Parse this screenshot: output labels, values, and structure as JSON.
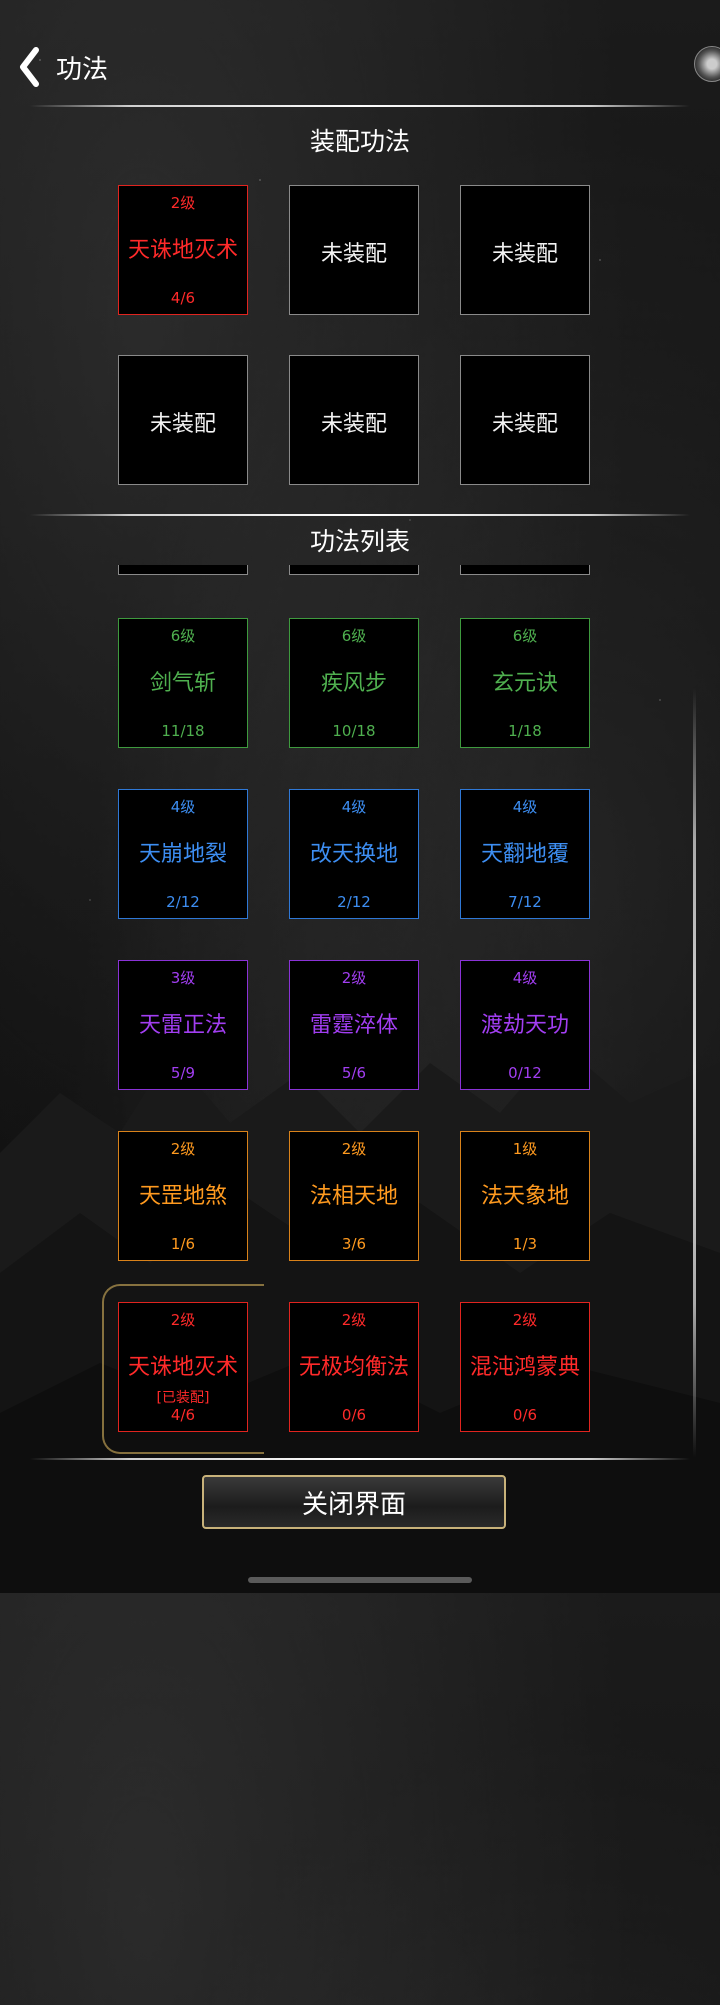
{
  "header": {
    "title": "功法"
  },
  "equipped": {
    "title": "装配功法",
    "slots": [
      {
        "level": "2级",
        "name": "天诛地灭术",
        "progress": "4/6",
        "color": "#ff2a2a",
        "border": "#e0241f"
      },
      {
        "name": "未装配"
      },
      {
        "name": "未装配"
      },
      {
        "name": "未装配"
      },
      {
        "name": "未装配"
      },
      {
        "name": "未装配"
      }
    ]
  },
  "list": {
    "title": "功法列表",
    "items": [
      {
        "level": "6级",
        "name": "剑气斩",
        "progress": "11/18",
        "color": "#4fb04f",
        "border": "#3e9a3e"
      },
      {
        "level": "6级",
        "name": "疾风步",
        "progress": "10/18",
        "color": "#4fb04f",
        "border": "#3e9a3e"
      },
      {
        "level": "6级",
        "name": "玄元诀",
        "progress": "1/18",
        "color": "#4fb04f",
        "border": "#3e9a3e"
      },
      {
        "level": "4级",
        "name": "天崩地裂",
        "progress": "2/12",
        "color": "#3d8ef2",
        "border": "#2f78d6"
      },
      {
        "level": "4级",
        "name": "改天换地",
        "progress": "2/12",
        "color": "#3d8ef2",
        "border": "#2f78d6"
      },
      {
        "level": "4级",
        "name": "天翻地覆",
        "progress": "7/12",
        "color": "#3d8ef2",
        "border": "#2f78d6"
      },
      {
        "level": "3级",
        "name": "天雷正法",
        "progress": "5/9",
        "color": "#a23ef2",
        "border": "#8a32d6"
      },
      {
        "level": "2级",
        "name": "雷霆淬体",
        "progress": "5/6",
        "color": "#a23ef2",
        "border": "#8a32d6"
      },
      {
        "level": "4级",
        "name": "渡劫天功",
        "progress": "0/12",
        "color": "#a23ef2",
        "border": "#8a32d6"
      },
      {
        "level": "2级",
        "name": "天罡地煞",
        "progress": "1/6",
        "color": "#ff9a1f",
        "border": "#d9821a"
      },
      {
        "level": "2级",
        "name": "法相天地",
        "progress": "3/6",
        "color": "#ff9a1f",
        "border": "#d9821a"
      },
      {
        "level": "1级",
        "name": "法天象地",
        "progress": "1/3",
        "color": "#ff9a1f",
        "border": "#d9821a"
      },
      {
        "level": "2级",
        "name": "天诛地灭术",
        "tag": "[已装配]",
        "progress": "4/6",
        "color": "#ff2a2a",
        "border": "#e0241f"
      },
      {
        "level": "2级",
        "name": "无极均衡法",
        "progress": "0/6",
        "color": "#ff2a2a",
        "border": "#e0241f"
      },
      {
        "level": "2级",
        "name": "混沌鸿蒙典",
        "progress": "0/6",
        "color": "#ff2a2a",
        "border": "#e0241f"
      }
    ]
  },
  "footer": {
    "close_label": "关闭界面"
  }
}
